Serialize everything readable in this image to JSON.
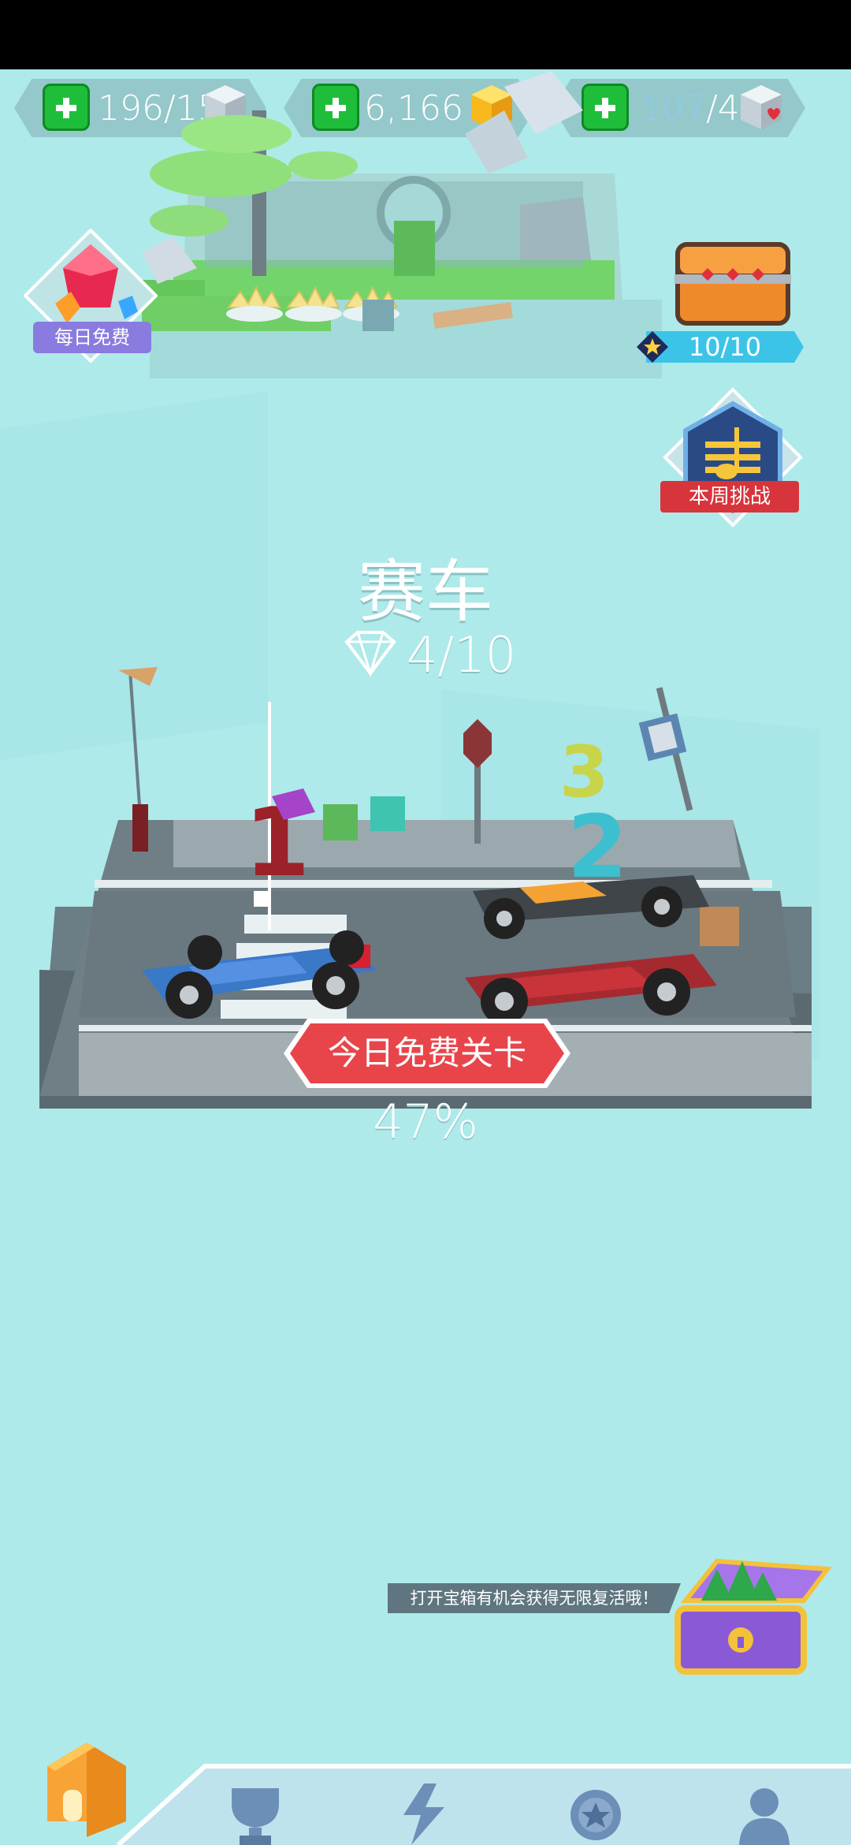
{
  "currency": {
    "cubes": {
      "value": "196/15"
    },
    "coins": {
      "value": "6,166"
    },
    "hearts": {
      "value": "/40"
    }
  },
  "daily_free": {
    "label": "每日免费"
  },
  "chest": {
    "progress": "10/10"
  },
  "weekly_challenge": {
    "label": "本周挑战"
  },
  "level": {
    "title": "赛车",
    "gems_progress": "4/10",
    "free_button_label": "今日免费关卡",
    "completion": "47%"
  },
  "hint": {
    "text": "打开宝箱有机会获得无限复活哦！"
  },
  "bottom_nav": {
    "items": [
      "home-icon",
      "trophy-icon",
      "lightning-icon",
      "medal-icon",
      "profile-icon"
    ]
  },
  "colors": {
    "background": "#aeeaea",
    "plus_green": "#1fbe3a",
    "free_button_red": "#e8454b",
    "weekly_red": "#d8343c",
    "chest_bar_blue": "#3cc4e8",
    "daily_purple": "#8a7be0"
  }
}
